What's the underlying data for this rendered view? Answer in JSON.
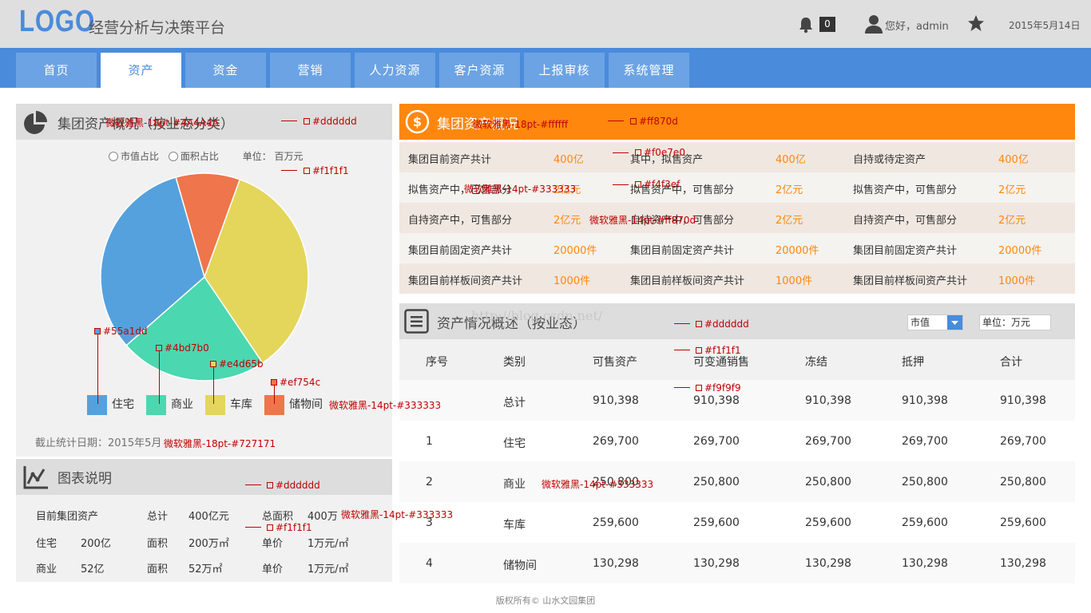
{
  "header": {
    "logo": "LOGO",
    "app_title": "经营分析与决策平台",
    "notifications": "0",
    "greeting": "您好，admin",
    "date": "2015年5月14日"
  },
  "nav": [
    "首页",
    "资产",
    "资金",
    "营销",
    "人力资源",
    "客户资源",
    "上报审核",
    "系统管理"
  ],
  "asset_dist": {
    "title": "集团资产概况（按业态分类）",
    "radio_market": "市值占比",
    "radio_area": "面积占比",
    "unit": "单位： 百万元",
    "legend": [
      "住宅",
      "商业",
      "车库",
      "储物间"
    ],
    "stat_date": "截止统计日期：2015年5月"
  },
  "chart_data": {
    "type": "pie",
    "categories": [
      "住宅",
      "商业",
      "车库",
      "储物间"
    ],
    "values": [
      32,
      23,
      35,
      10
    ],
    "colors": [
      "#55a1dd",
      "#4bd7b0",
      "#e4d65b",
      "#ef754c"
    ]
  },
  "chart_note": {
    "title": "图表说明",
    "rows": [
      [
        "目前集团资产",
        "总计",
        "400亿元",
        "总面积",
        "400万"
      ],
      [
        "住宅",
        "200亿",
        "面积",
        "200万㎡",
        "单价",
        "1万元/㎡"
      ],
      [
        "商业",
        "52亿",
        "面积",
        "52万㎡",
        "单价",
        "1万元/㎡"
      ]
    ]
  },
  "overview": {
    "title": "集团资产概况",
    "rows": [
      [
        "集团目前资产共计",
        "400亿",
        "其中，拟售资产",
        "400亿",
        "自持或待定资产",
        "400亿"
      ],
      [
        "拟售资产中，已售部分",
        "2亿元",
        "拟售资产中，可售部分",
        "2亿元",
        "拟售资产中，可售部分",
        "2亿元"
      ],
      [
        "自持资产中，可售部分",
        "2亿元",
        "自持资产中，可售部分",
        "2亿元",
        "自持资产中，可售部分",
        "2亿元"
      ],
      [
        "集团目前固定资产共计",
        "20000件",
        "集团目前固定资产共计",
        "20000件",
        "集团目前固定资产共计",
        "20000件"
      ],
      [
        "集团目前样板间资产共计",
        "1000件",
        "集团目前样板间资产共计",
        "1000件",
        "集团目前样板间资产共计",
        "1000件"
      ]
    ],
    "row_colors": [
      "#f0e7e0",
      "#f4f3ef",
      "#f0e7e0",
      "#f4f3ef",
      "#f0e7e0"
    ]
  },
  "status_table": {
    "title": "资产情况概述（按业态）",
    "select_value": "市值",
    "unit": "单位：万元",
    "headers": [
      "序号",
      "类别",
      "可售资产",
      "可变通销售",
      "冻结",
      "抵押",
      "合计"
    ],
    "rows": [
      [
        "",
        "总计",
        "910,398",
        "910,398",
        "910,398",
        "910,398",
        "910,398"
      ],
      [
        "1",
        "住宅",
        "269,700",
        "269,700",
        "269,700",
        "269,700",
        "269,700"
      ],
      [
        "2",
        "商业",
        "250,800",
        "250,800",
        "250,800",
        "250,800",
        "250,800"
      ],
      [
        "3",
        "车库",
        "259,600",
        "259,600",
        "259,600",
        "259,600",
        "259,600"
      ],
      [
        "4",
        "储物间",
        "130,298",
        "130,298",
        "130,298",
        "130,298",
        "130,298"
      ]
    ]
  },
  "annotations": {
    "a1": "微软雅黑-18pt-#4A4A4A",
    "a2": "#dddddd",
    "a3": "#f1f1f1",
    "a4": "#55a1dd",
    "a5": "#4bd7b0",
    "a6": "#e4d65b",
    "a7": "#ef754c",
    "a8": "微软雅黑-14pt-#333333",
    "a9": "微软雅黑-18pt-#727171",
    "a10": "#dddddd",
    "a11": "#f1f1f1",
    "a12": "微软雅黑-14pt-#333333",
    "a13": "微软雅黑-18pt-#ffffff",
    "a14": "#ff870d",
    "a15": "#f0e7e0",
    "a16": "#f4f3ef",
    "a17": "微软雅黑-14pt-#333333",
    "a18": "微软雅黑-14pt-#ff870d",
    "a19": "#dddddd",
    "a20": "#f1f1f1",
    "a21": "#f9f9f9",
    "a22": "微软雅黑-14pt-#333333"
  },
  "watermark": "http://blog.csdn.net/",
  "footer": "版权所有© 山水文园集团"
}
